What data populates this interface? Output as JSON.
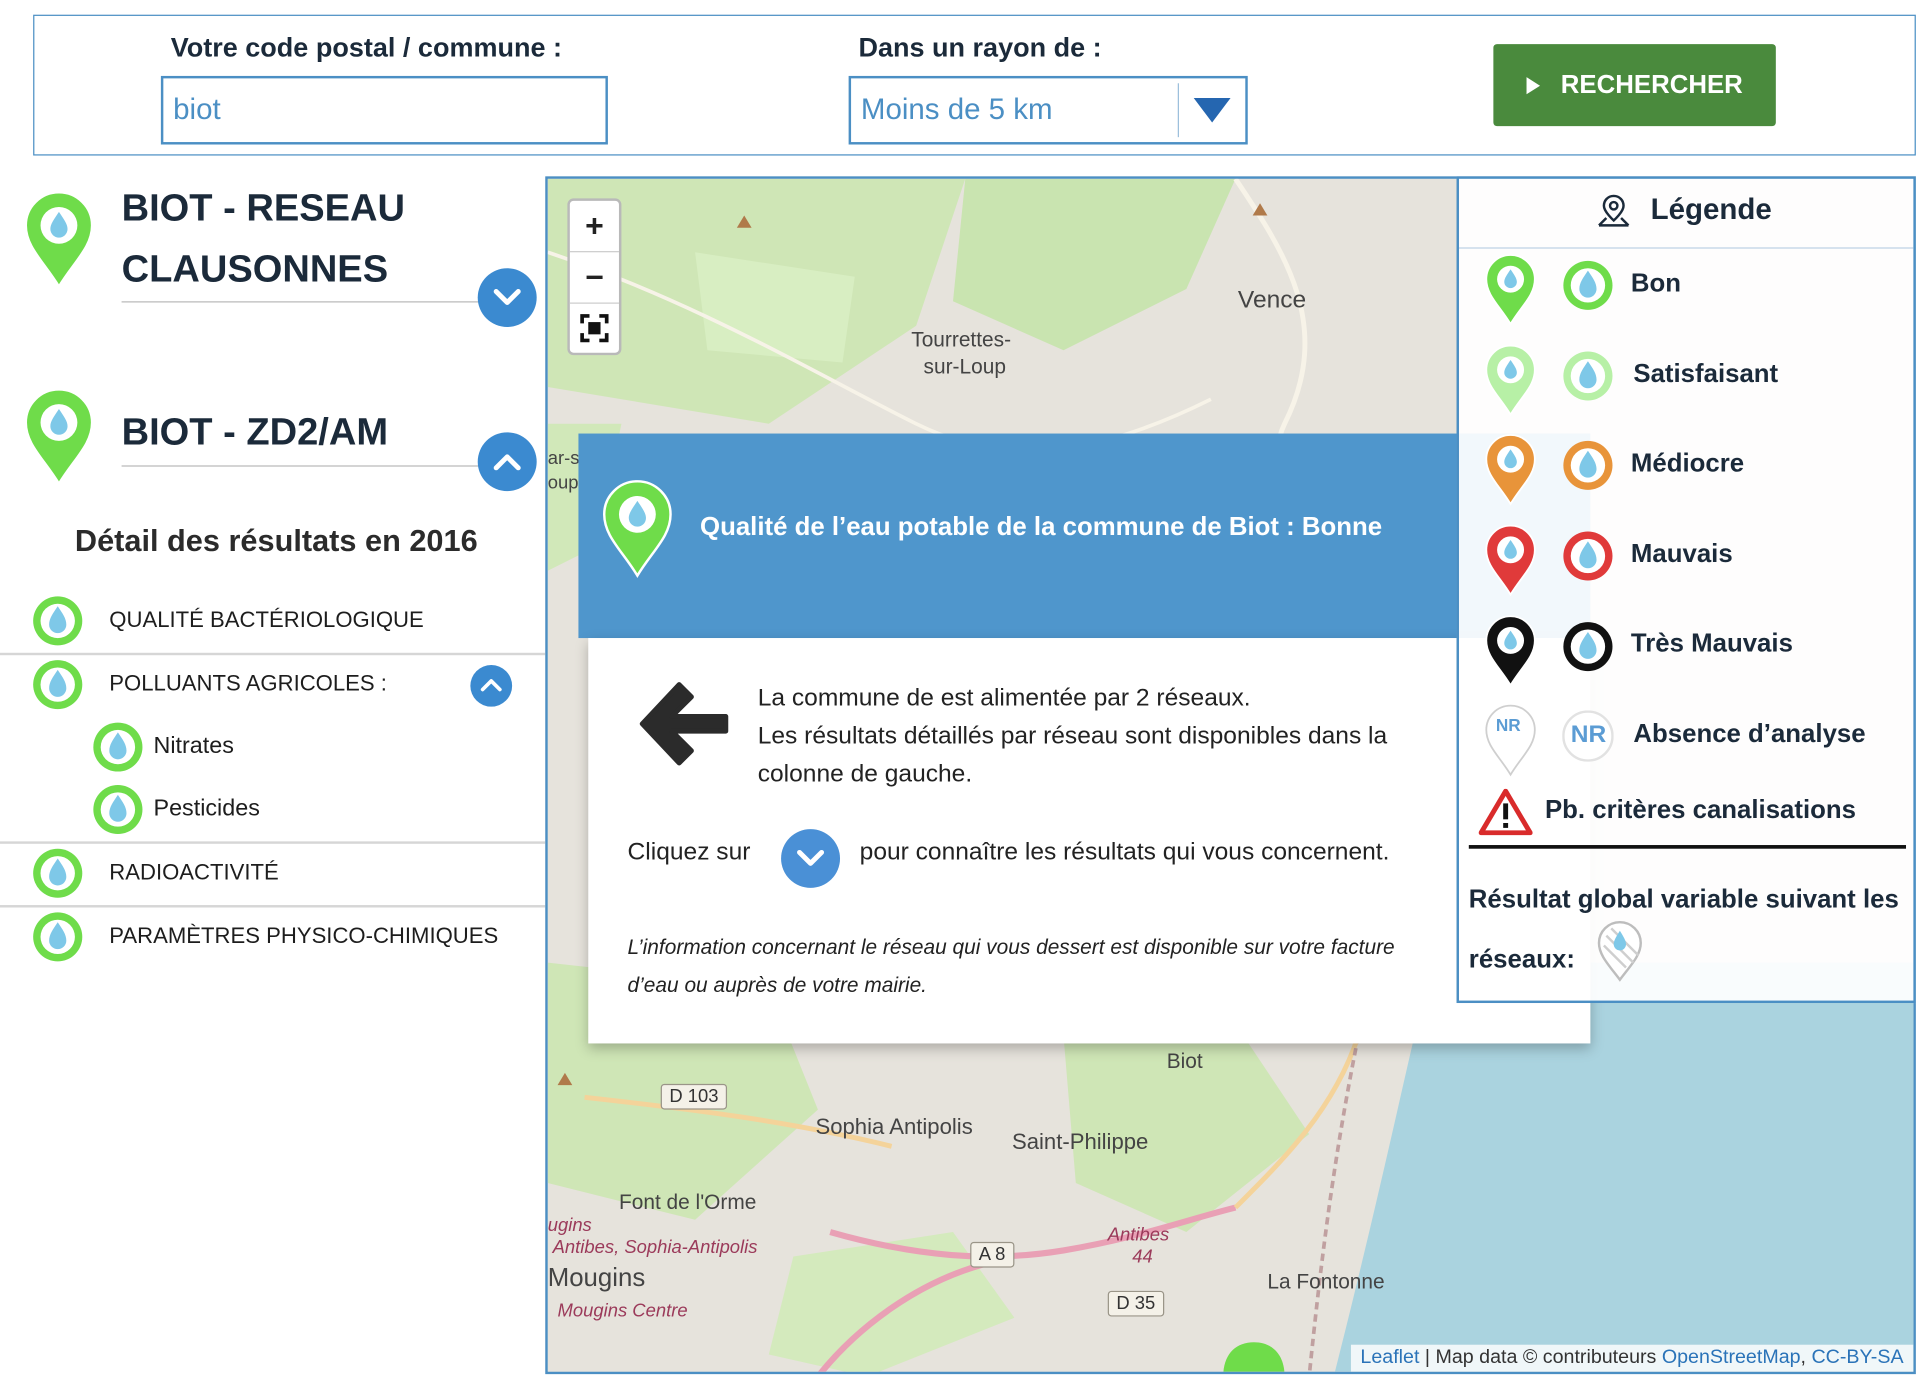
{
  "search": {
    "postal_label": "Votre code postal / commune :",
    "postal_value": "biot",
    "radius_label": "Dans un rayon de :",
    "radius_value": "Moins de 5 km",
    "search_button": "RECHERCHER"
  },
  "sidebar": {
    "networks": [
      {
        "title_line1": "BIOT - RESEAU",
        "title_line2": "CLAUSONNES",
        "status": "Bon"
      },
      {
        "title_line1": "BIOT - ZD2/AM",
        "status": "Bon"
      }
    ],
    "detail_heading": "Détail des résultats en 2016",
    "results": [
      {
        "label": "QUALITÉ BACTÉRIOLOGIQUE"
      },
      {
        "label": "POLLUANTS AGRICOLES :"
      },
      {
        "label": "Nitrates"
      },
      {
        "label": "Pesticides"
      },
      {
        "label": "RADIOACTIVITÉ"
      },
      {
        "label": "PARAMÈTRES PHYSICO-CHIMIQUES"
      }
    ]
  },
  "map": {
    "zoom_in": "+",
    "zoom_out": "−",
    "places": [
      "Vence",
      "Tourrettes-",
      "sur-Loup",
      "Sophia Antipolis",
      "Saint-Philippe",
      "Biot",
      "Font de l'Orme",
      "Mougins",
      "La Fontonne",
      "ar-s",
      "oup"
    ],
    "italic_places": [
      "Antibes, Sophia-Antipolis",
      "Mougins Centre",
      "Antibes",
      "ugins"
    ],
    "roads": [
      "D 103",
      "A 8",
      "D 35",
      "44"
    ],
    "attribution": {
      "leaflet": "Leaflet",
      "sep": " | Map data © contributeurs ",
      "osm": "OpenStreetMap",
      "comma": ", ",
      "license": "CC-BY-SA"
    }
  },
  "modal": {
    "title": "Qualité de l’eau potable de la commune de Biot : Bonne",
    "line1": "La commune de est alimentée par 2 réseaux.",
    "line2": "Les résultats détaillés par réseau sont disponibles dans la",
    "line3": "colonne de gauche.",
    "click_before": "Cliquez sur",
    "click_after": "pour connaître les résultats qui vous concernent.",
    "italic1": "L’information concernant le réseau qui vous dessert est disponible sur votre facture",
    "italic2": "d’eau ou auprès de votre mairie."
  },
  "legend": {
    "title": "Légende",
    "items": [
      {
        "label": "Bon",
        "color": "#6fdc4a"
      },
      {
        "label": "Satisfaisant",
        "color": "#b7f0a6"
      },
      {
        "label": "Médiocre",
        "color": "#e8943a"
      },
      {
        "label": "Mauvais",
        "color": "#e03a3a"
      },
      {
        "label": "Très Mauvais",
        "color": "#111111"
      },
      {
        "label": "Absence d’analyse",
        "color": "#ffffff"
      }
    ],
    "nr": "NR",
    "warning": "Pb. critères canalisations",
    "note": "Résultat global variable suivant les réseaux:"
  },
  "colors": {
    "accent": "#4b8fc4",
    "button_green": "#4a8a3d",
    "modal_blue": "#4f96cc",
    "sea": "#aad3df"
  }
}
